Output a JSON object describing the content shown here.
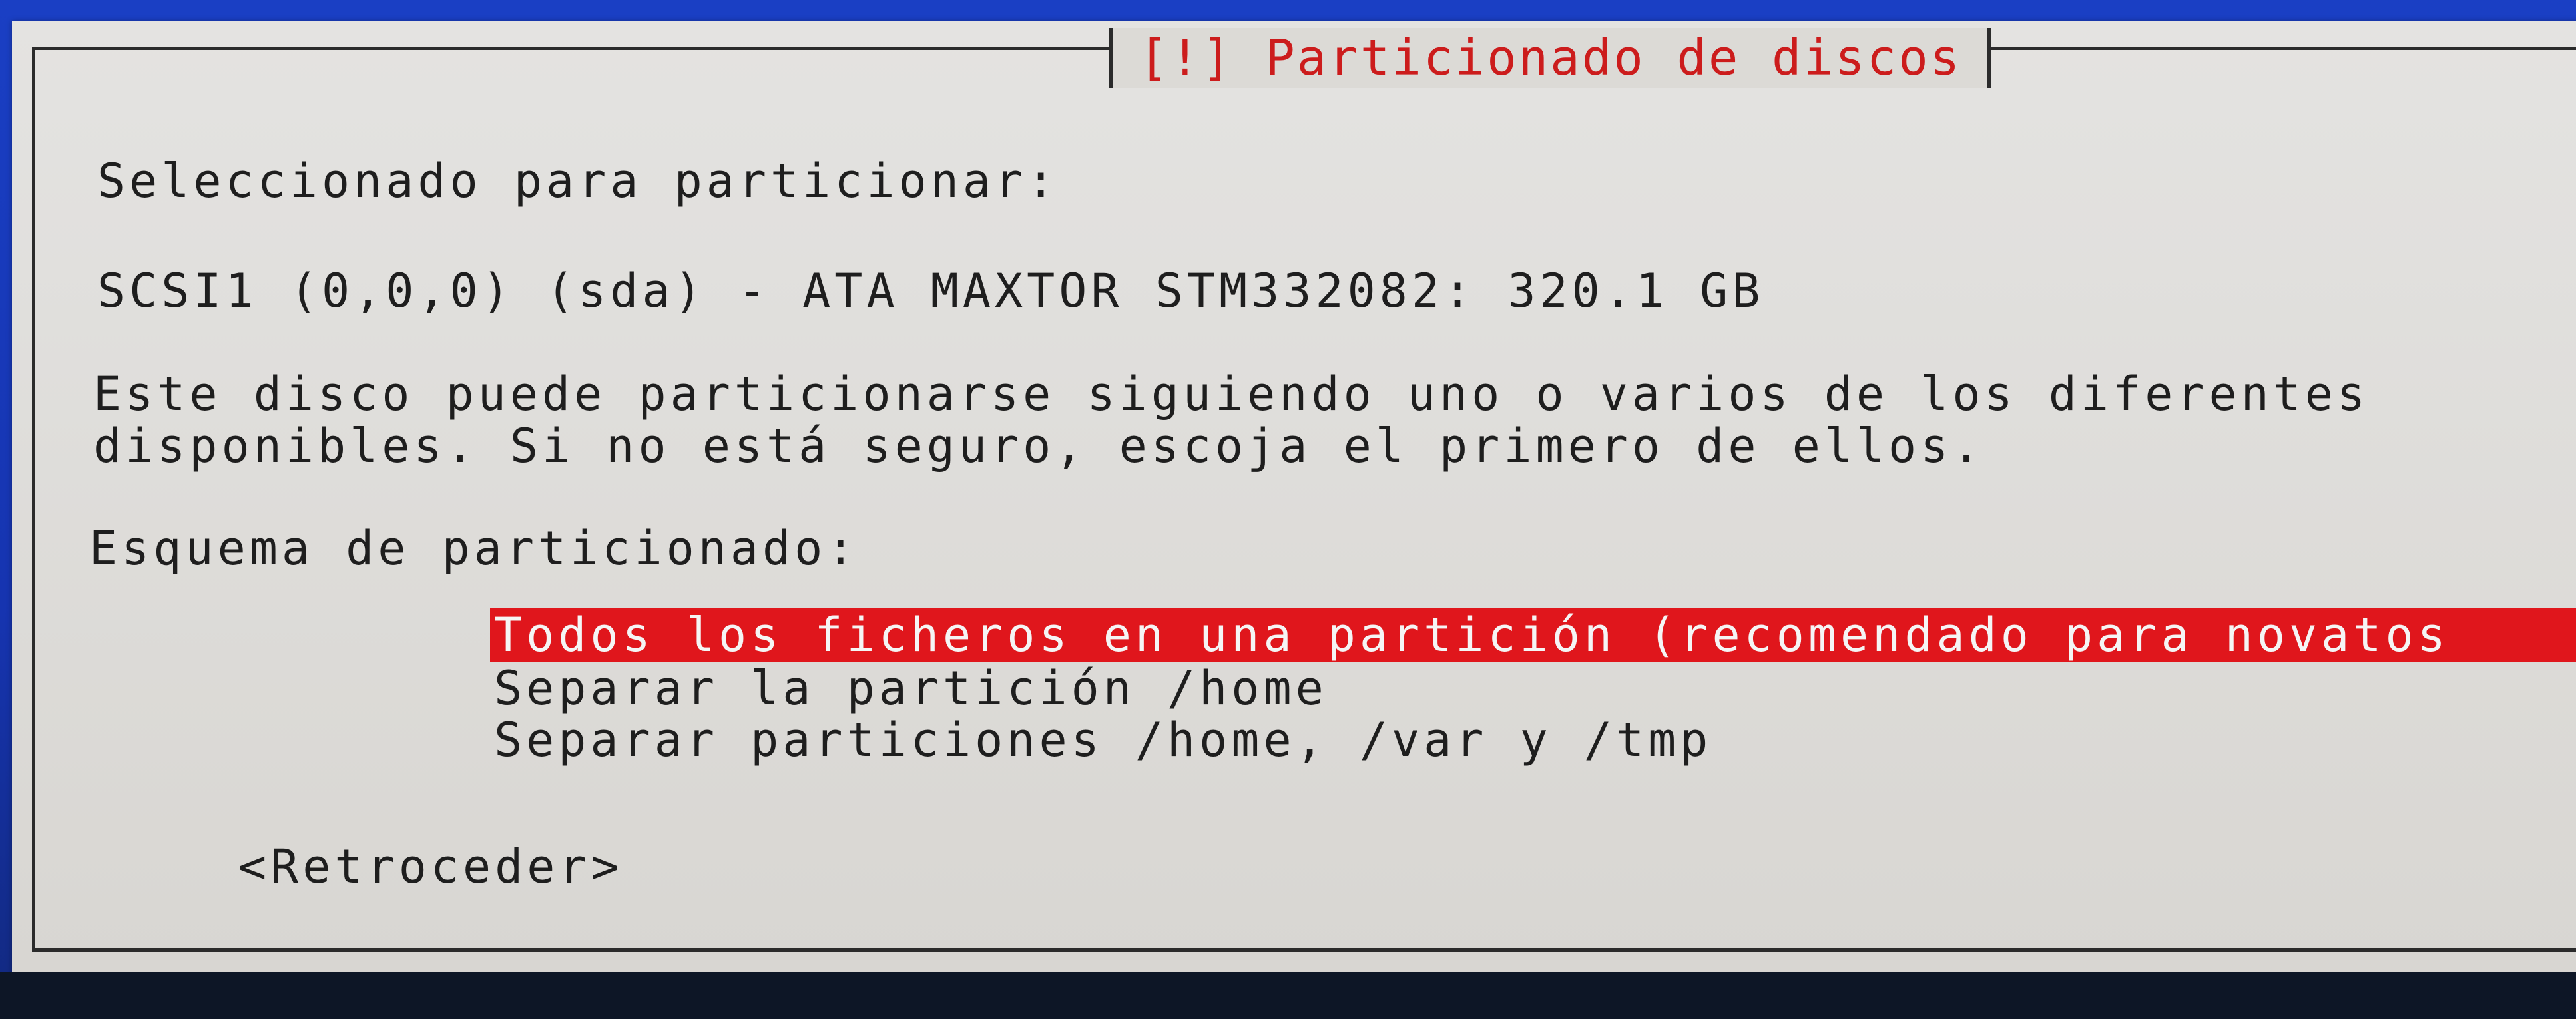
{
  "dialog": {
    "title": "[!] Particionado de discos",
    "selected_label": "Seleccionado para particionar:",
    "disk": "SCSI1 (0,0,0) (sda) - ATA MAXTOR STM332082: 320.1 GB",
    "description_line1": "Este disco puede particionarse siguiendo uno o varios de los diferentes",
    "description_line2": "disponibles. Si no está seguro, escoja el primero de ellos.",
    "scheme_label": "Esquema de particionado:",
    "options": [
      {
        "label": "Todos los ficheros en una partición (recomendado para novatos",
        "selected": true
      },
      {
        "label": "Separar la partición /home",
        "selected": false
      },
      {
        "label": "Separar particiones /home, /var y /tmp",
        "selected": false
      }
    ],
    "back_button": "<Retroceder>"
  },
  "colors": {
    "background": "#1a3fc4",
    "dialog": "#dcdad6",
    "highlight": "#e0161c",
    "title": "#cc1c1c"
  }
}
